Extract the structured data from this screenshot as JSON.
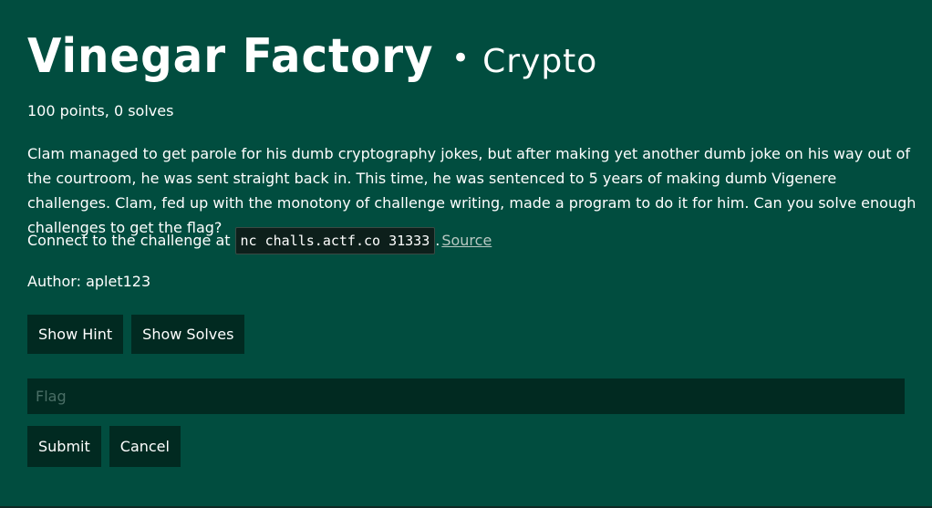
{
  "challenge": {
    "title": "Vinegar Factory",
    "separator": "•",
    "category": "Crypto",
    "meta": "100 points, 0 solves",
    "description": "Clam managed to get parole for his dumb cryptography jokes, but after making yet another dumb joke on his way out of the courtroom, he was sent straight back in. This time, he was sentenced to 5 years of making dumb Vigenere challenges. Clam, fed up with the monotony of challenge writing, made a program to do it for him. Can you solve enough challenges to get the flag?",
    "connect_prefix": "Connect to the challenge at",
    "connect_command": "nc challs.actf.co 31333",
    "connect_punct": ".",
    "source_label": "Source",
    "author": "Author: aplet123"
  },
  "buttons": {
    "show_hint": "Show Hint",
    "show_solves": "Show Solves",
    "submit": "Submit",
    "cancel": "Cancel"
  },
  "flag_input": {
    "value": "",
    "placeholder": "Flag"
  },
  "colors": {
    "background": "#014d3f",
    "button_bg": "#012a21",
    "code_bg": "#0d1f1b",
    "link": "#b8c8c2"
  }
}
